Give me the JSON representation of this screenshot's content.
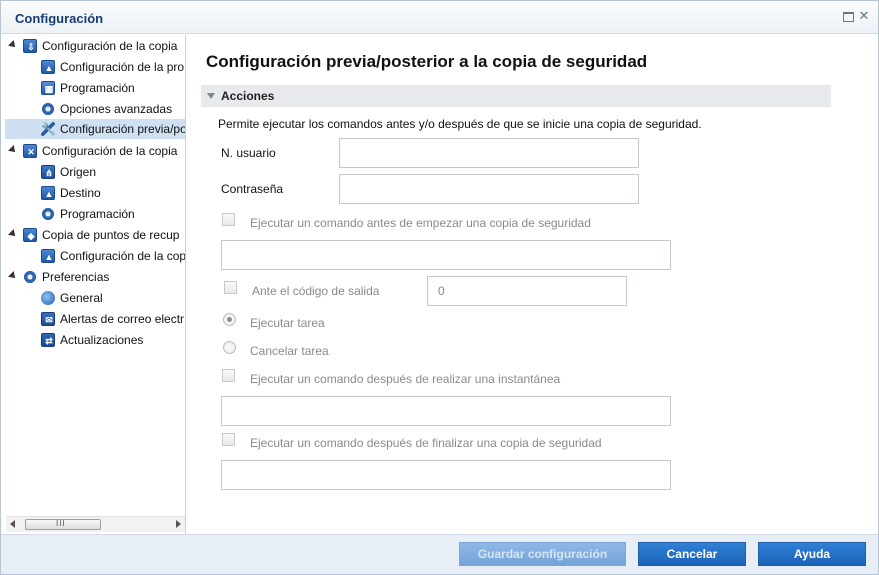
{
  "window": {
    "title": "Configuración"
  },
  "tree": {
    "items": [
      {
        "label": "Configuración de la copia",
        "level": 0,
        "expanded": true,
        "icon": "backup-settings-icon"
      },
      {
        "label": "Configuración de la pro",
        "level": 1,
        "icon": "protection-settings-icon"
      },
      {
        "label": "Programación",
        "level": 1,
        "icon": "schedule-icon"
      },
      {
        "label": "Opciones avanzadas",
        "level": 1,
        "icon": "advanced-options-icon"
      },
      {
        "label": "Configuración previa/po",
        "level": 1,
        "icon": "wrench-icon",
        "selected": true
      },
      {
        "label": "Configuración de la copia",
        "level": 0,
        "expanded": true,
        "icon": "file-copy-settings-icon"
      },
      {
        "label": "Origen",
        "level": 1,
        "icon": "source-icon"
      },
      {
        "label": "Destino",
        "level": 1,
        "icon": "destination-icon"
      },
      {
        "label": "Programación",
        "level": 1,
        "icon": "schedule-icon"
      },
      {
        "label": "Copia de puntos de recup",
        "level": 0,
        "expanded": true,
        "icon": "recovery-point-copy-icon"
      },
      {
        "label": "Configuración de la cop",
        "level": 1,
        "icon": "copy-settings-icon"
      },
      {
        "label": "Preferencias",
        "level": 0,
        "expanded": true,
        "icon": "preferences-icon"
      },
      {
        "label": "General",
        "level": 1,
        "icon": "globe-icon"
      },
      {
        "label": "Alertas de correo electr",
        "level": 1,
        "icon": "mail-icon"
      },
      {
        "label": "Actualizaciones",
        "level": 1,
        "icon": "updates-icon"
      }
    ]
  },
  "main": {
    "title": "Configuración previa/posterior a la copia de seguridad",
    "section": "Acciones",
    "description": "Permite ejecutar los comandos antes y/o después de que se inicie una copia de seguridad.",
    "username_label": "N. usuario",
    "username_value": "",
    "password_label": "Contraseña",
    "password_value": "",
    "pre_command_label": "Ejecutar un comando antes de empezar una copia de seguridad",
    "pre_command_value": "",
    "exit_code_label": "Ante el código de salida",
    "exit_code_value": "0",
    "run_job_label": "Ejecutar tarea",
    "cancel_job_label": "Cancelar tarea",
    "post_snapshot_label": "Ejecutar un comando después de realizar una instantánea",
    "post_snapshot_value": "",
    "post_backup_label": "Ejecutar un comando después de finalizar una copia de seguridad",
    "post_backup_value": ""
  },
  "scrollbar": {
    "thumb_glyph": "III"
  },
  "footer": {
    "save_label": "Guardar configuración",
    "cancel_label": "Cancelar",
    "help_label": "Ayuda"
  }
}
